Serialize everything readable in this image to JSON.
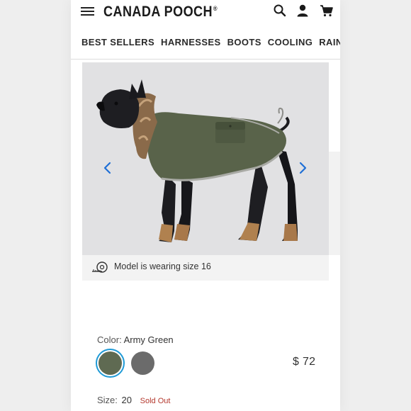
{
  "header": {
    "logo_text": "CANADA POOCH",
    "logo_mark": "®"
  },
  "icons": {
    "menu": "hamburger-menu-icon",
    "search": "search-icon",
    "account": "user-icon",
    "cart": "cart-icon"
  },
  "nav": {
    "items": [
      "BEST SELLERS",
      "HARNESSES",
      "BOOTS",
      "COOLING",
      "RAINWEAR"
    ]
  },
  "gallery": {
    "image_alt": "dog-wearing-army-green-parka",
    "prev_icon": "chevron-left-icon",
    "next_icon": "chevron-right-icon",
    "caption": "Model is wearing size 16",
    "caption_icon": "measuring-tape-icon"
  },
  "product": {
    "color_label": "Color:",
    "color_value": "Army Green",
    "swatches": [
      {
        "name": "Army Green",
        "color": "#5f6a52",
        "selected": true
      },
      {
        "name": "Grey",
        "color": "#6b6b6b",
        "selected": false
      }
    ],
    "price": "$ 72",
    "size_label": "Size:",
    "size_value": "20",
    "size_status": "Sold Out"
  },
  "colors": {
    "accent": "#1f9ad6",
    "sold_out": "#b4382d"
  }
}
